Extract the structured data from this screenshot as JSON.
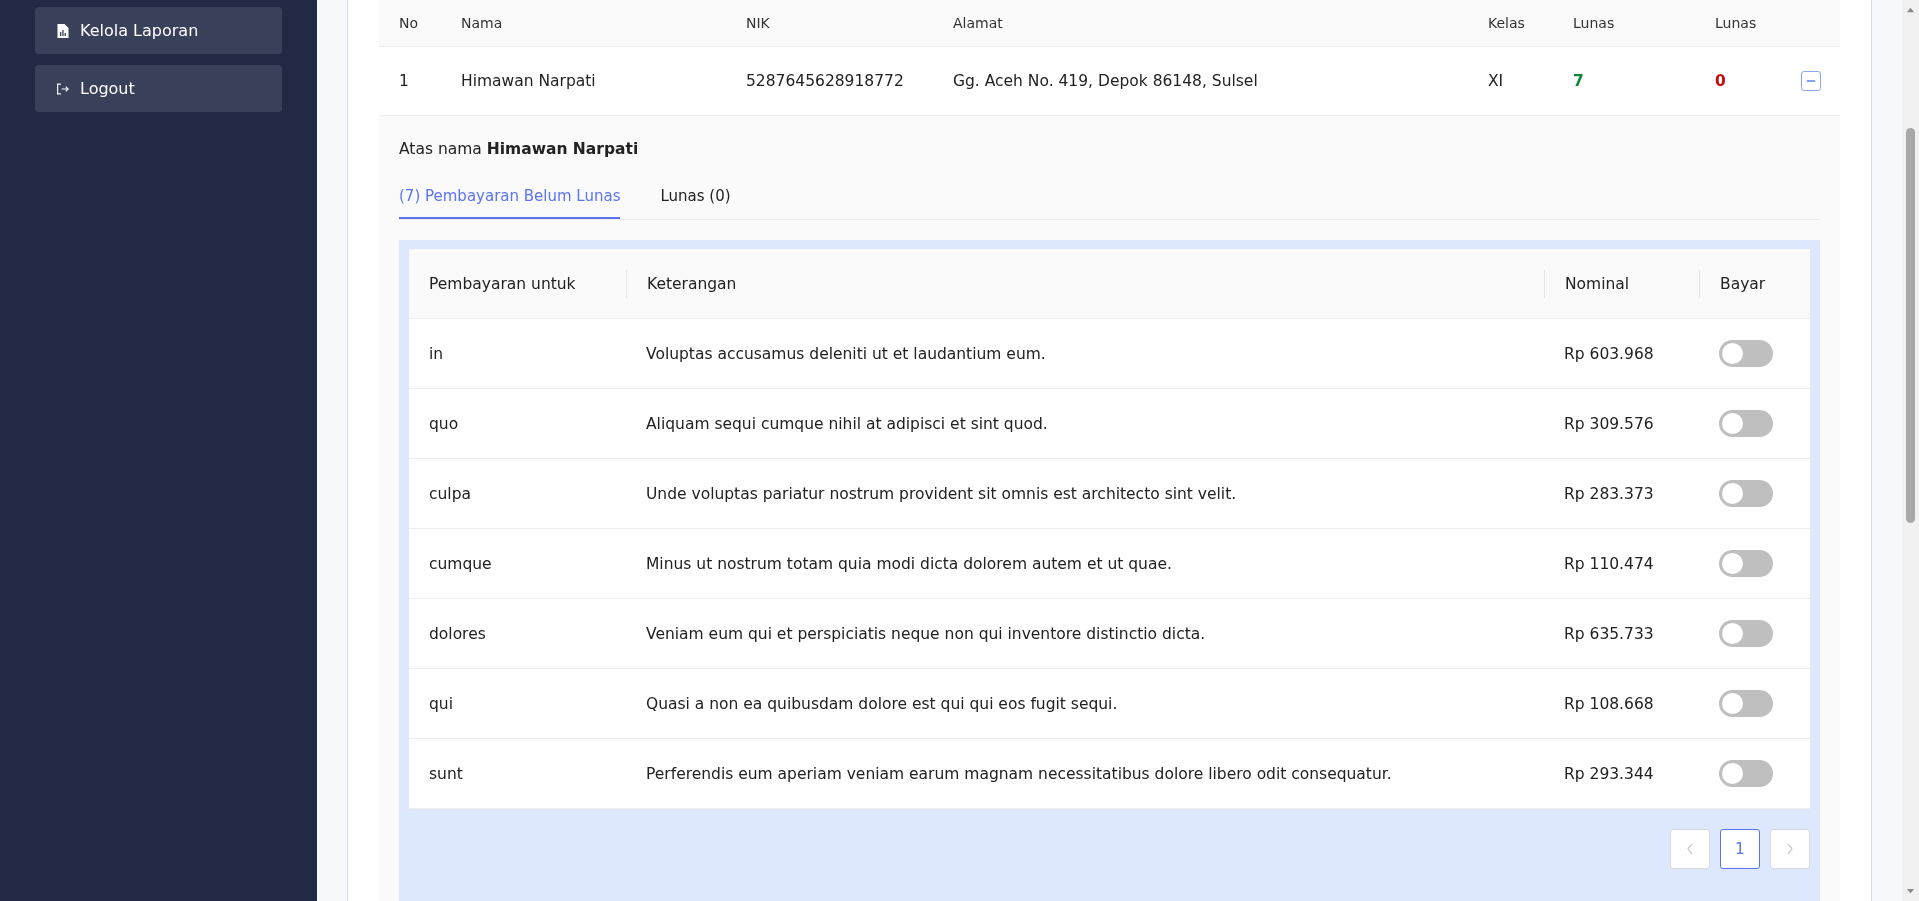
{
  "sidebar": {
    "items": [
      {
        "label": "Kelola Laporan",
        "kind": "report"
      },
      {
        "label": "Logout",
        "kind": "logout"
      }
    ]
  },
  "students_table": {
    "columns": [
      "No",
      "Nama",
      "NIK",
      "Alamat",
      "Kelas",
      "Lunas",
      "Lunas"
    ],
    "rows": [
      {
        "no": "1",
        "nama": "Himawan Narpati",
        "nik": "5287645628918772",
        "alamat": "Gg. Aceh No. 419, Depok 86148, Sulsel",
        "kelas": "XI",
        "belum_lunas": "7",
        "lunas": "0",
        "expanded": true
      }
    ]
  },
  "detail": {
    "owner": "Atas nama **Himawan Narpati**",
    "tabs": [
      {
        "label": "(7) Pembayaran Belum Lunas",
        "selected": true
      },
      {
        "label": "Lunas (0)",
        "selected": false
      }
    ],
    "payments": {
      "columns": [
        "Pembayaran untuk",
        "Keterangan",
        "Nominal",
        "Bayar"
      ],
      "rows": [
        {
          "untuk": "in",
          "keterangan": "Voluptas accusamus deleniti ut et laudantium eum.",
          "nominal": "Rp 603.968",
          "on": false
        },
        {
          "untuk": "quo",
          "keterangan": "Aliquam sequi cumque nihil at adipisci et sint quod.",
          "nominal": "Rp 309.576",
          "on": false
        },
        {
          "untuk": "culpa",
          "keterangan": "Unde voluptas pariatur nostrum provident sit omnis est architecto sint velit.",
          "nominal": "Rp 283.373",
          "on": false
        },
        {
          "untuk": "cumque",
          "keterangan": "Minus ut nostrum totam quia modi dicta dolorem autem et ut quae.",
          "nominal": "Rp 110.474",
          "on": false
        },
        {
          "untuk": "dolores",
          "keterangan": "Veniam eum qui et perspiciatis neque non qui inventore distinctio dicta.",
          "nominal": "Rp 635.733",
          "on": false
        },
        {
          "untuk": "qui",
          "keterangan": "Quasi a non ea quibusdam dolore est qui qui eos fugit sequi.",
          "nominal": "Rp 108.668",
          "on": false
        },
        {
          "untuk": "sunt",
          "keterangan": "Perferendis eum aperiam veniam earum magnam necessitatibus dolore libero odit consequatur.",
          "nominal": "Rp 293.344",
          "on": false
        }
      ]
    },
    "pagination": {
      "prev_disabled": true,
      "next_disabled": true,
      "pages": [
        {
          "label": "1",
          "selected": true
        }
      ]
    }
  }
}
